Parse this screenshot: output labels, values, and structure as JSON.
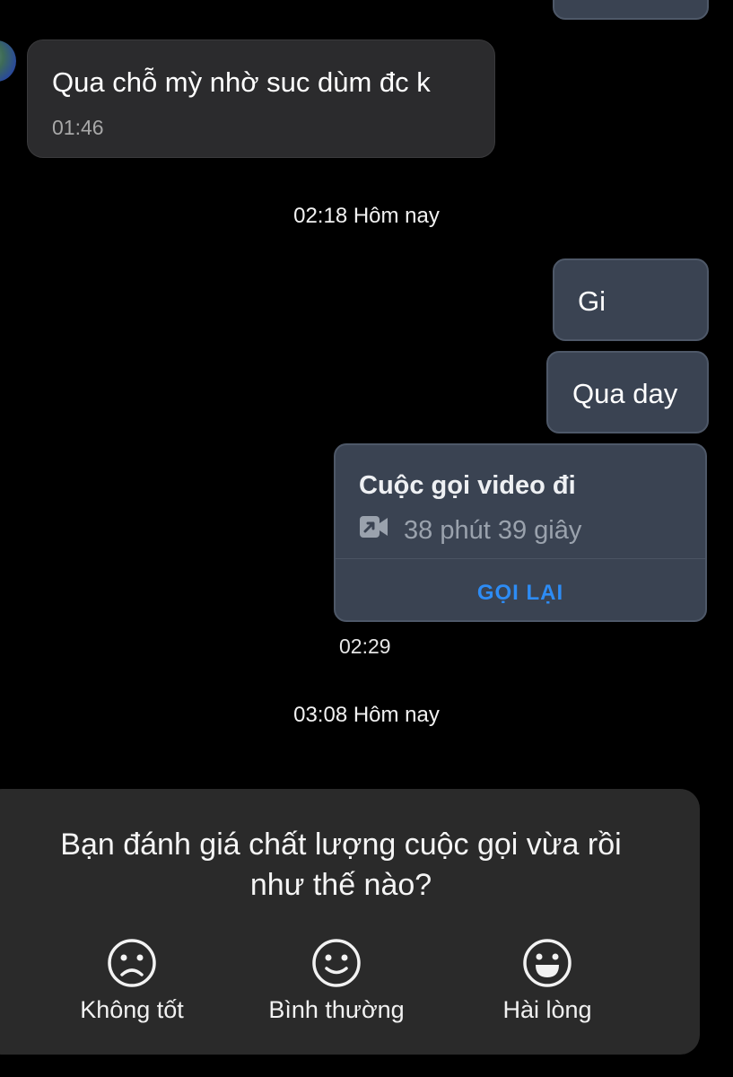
{
  "messages": [
    {
      "text": "Qua chỗ mỳ nhờ suc dùm đc k",
      "time": "01:46"
    },
    {
      "text": "Gi"
    },
    {
      "text": "Qua day"
    }
  ],
  "date_separators": [
    "02:18 Hôm nay",
    "03:08 Hôm nay"
  ],
  "call": {
    "title": "Cuộc gọi video đi",
    "duration": "38 phút 39 giây",
    "action": "GỌI LẠI",
    "time": "02:29",
    "icon": "video-call-outgoing-icon"
  },
  "rating": {
    "question_line1": "Bạn đánh giá chất lượng cuộc gọi vừa rồi",
    "question_line2": "như thế nào?",
    "options": [
      {
        "label": "Không tốt",
        "icon": "sad-face-icon"
      },
      {
        "label": "Bình thường",
        "icon": "neutral-face-icon"
      },
      {
        "label": "Hài lòng",
        "icon": "happy-face-icon"
      }
    ]
  },
  "colors": {
    "background": "#000000",
    "incoming_bubble": "#2b2b2d",
    "outgoing_bubble": "#3a4352",
    "accent": "#2d8cf5"
  }
}
